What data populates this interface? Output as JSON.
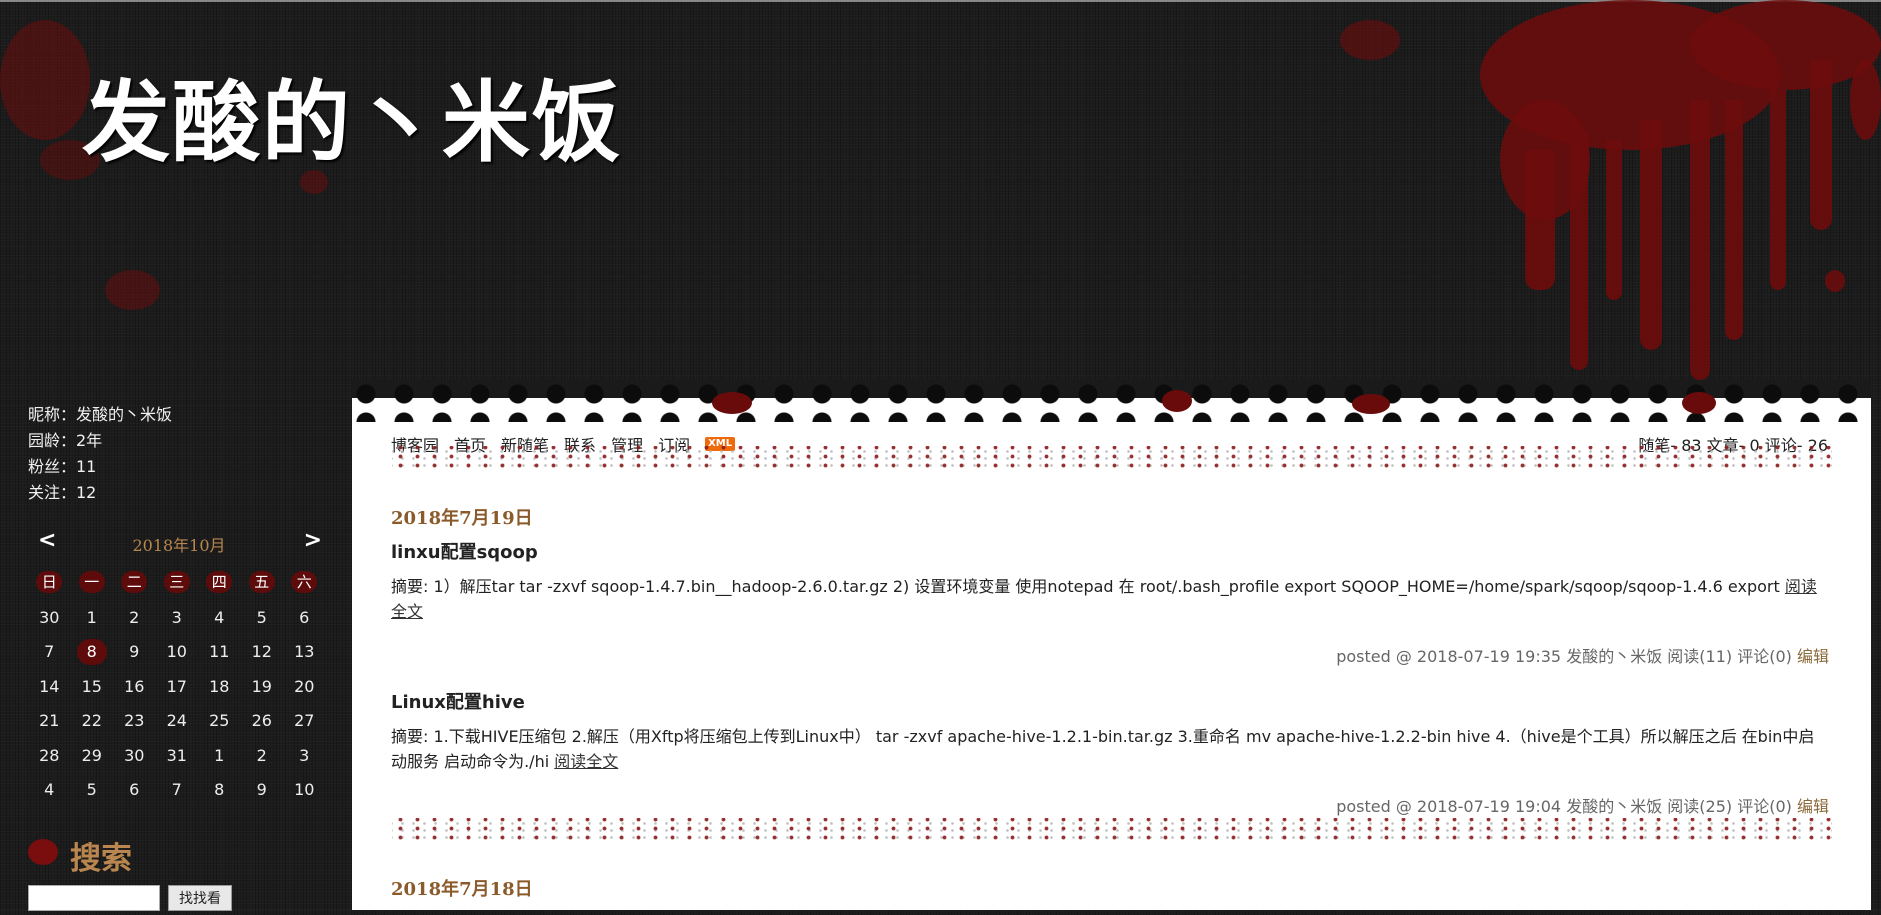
{
  "site": {
    "title": "发酸的丶米饭"
  },
  "profile": {
    "nickname": "昵称：发酸的丶米饭",
    "age": "园龄：2年",
    "fans": "粉丝：11",
    "follow": "关注：12"
  },
  "calendar": {
    "prev": "<",
    "next": ">",
    "title": "2018年10月",
    "weekdays": [
      "日",
      "一",
      "二",
      "三",
      "四",
      "五",
      "六"
    ],
    "weeks": [
      [
        "30",
        "1",
        "2",
        "3",
        "4",
        "5",
        "6"
      ],
      [
        "7",
        "8",
        "9",
        "10",
        "11",
        "12",
        "13"
      ],
      [
        "14",
        "15",
        "16",
        "17",
        "18",
        "19",
        "20"
      ],
      [
        "21",
        "22",
        "23",
        "24",
        "25",
        "26",
        "27"
      ],
      [
        "28",
        "29",
        "30",
        "31",
        "1",
        "2",
        "3"
      ],
      [
        "4",
        "5",
        "6",
        "7",
        "8",
        "9",
        "10"
      ]
    ],
    "today": "8"
  },
  "search": {
    "title": "搜索",
    "button": "找找看",
    "value": ""
  },
  "nav": {
    "items": [
      "博客园",
      "首页",
      "新随笔",
      "联系",
      "管理",
      "订阅"
    ],
    "xml": "XML"
  },
  "stats": {
    "text": "随笔- 83  文章- 0  评论- 26"
  },
  "posts": [
    {
      "date": "2018年7月19日",
      "title": "linxu配置sqoop",
      "summary": "摘要: 1）解压tar tar -zxvf sqoop-1.4.7.bin__hadoop-2.6.0.tar.gz 2) 设置环境变量 使用notepad 在 root/.bash_profile export SQOOP_HOME=/home/spark/sqoop/sqoop-1.4.6 export",
      "read_more": "阅读全文",
      "meta": "posted @ 2018-07-19 19:35 发酸的丶米饭 阅读(11) 评论(0)",
      "edit": "编辑"
    },
    {
      "title": "Linux配置hive",
      "summary": "摘要: 1.下载HIVE压缩包 2.解压（用Xftp将压缩包上传到Linux中） tar -zxvf apache-hive-1.2.1-bin.tar.gz 3.重命名 mv apache-hive-1.2.2-bin hive 4.（hive是个工具）所以解压之后 在bin中启动服务 启动命令为./hi",
      "read_more": "阅读全文",
      "meta": "posted @ 2018-07-19 19:04 发酸的丶米饭 阅读(25) 评论(0)",
      "edit": "编辑"
    }
  ],
  "next_date": "2018年7月18日",
  "colors": {
    "blood": "#6e0c0c",
    "accent": "#b8864e",
    "date": "#8a5a2b"
  }
}
